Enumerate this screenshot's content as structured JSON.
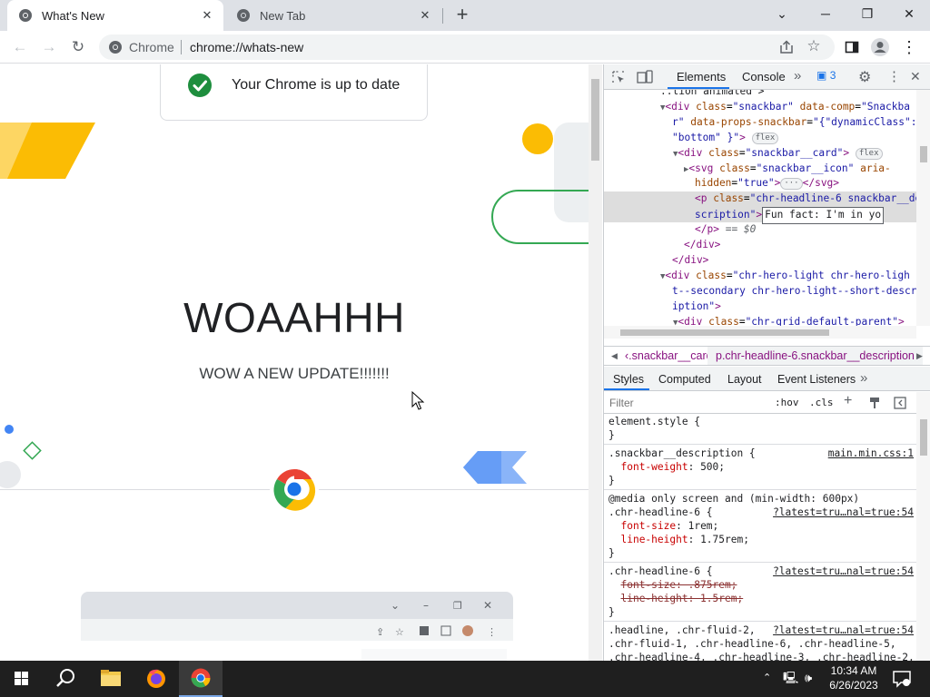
{
  "browser": {
    "tabs": [
      {
        "title": "What's New",
        "active": true
      },
      {
        "title": "New Tab",
        "active": false
      }
    ],
    "omnibox": {
      "chip": "Chrome",
      "url": "chrome://whats-new"
    }
  },
  "page": {
    "snackbar_text": "Your Chrome is up to date",
    "headline": "WOAAHHH",
    "subheadline": "WOW A NEW UPDATE!!!!!!!"
  },
  "devtools": {
    "tabs": [
      "Elements",
      "Console"
    ],
    "issues_count": "3",
    "dom_lines": [
      {
        "ind": 62,
        "html": "<span class='tx'>..tion animated\"&gt;</span>"
      },
      {
        "ind": 62,
        "html": "<span class='tri'>▼</span><span class='tag'>&lt;div</span> <span class='an'>class</span>=<span class='av'>\"snackbar\"</span> <span class='an'>data-comp</span>=<span class='av'>\"Snackba</span>"
      },
      {
        "ind": 75,
        "html": "<span class='av'>r\"</span> <span class='an'>data-props-snackbar</span>=<span class='av'>\"{\"dynamicClass\":</span>"
      },
      {
        "ind": 75,
        "html": "<span class='av'>\"bottom\" }\"</span><span class='tag'>&gt;</span> <span class='badge'>flex</span>"
      },
      {
        "ind": 76,
        "html": "<span class='tri'>▼</span><span class='tag'>&lt;div</span> <span class='an'>class</span>=<span class='av'>\"snackbar__card\"</span><span class='tag'>&gt;</span> <span class='badge'>flex</span>"
      },
      {
        "ind": 88,
        "html": "<span class='tri'>▶</span><span class='tag'>&lt;svg</span> <span class='an'>class</span>=<span class='av'>\"snackbar__icon\"</span> <span class='an'>aria-</span>"
      },
      {
        "ind": 100,
        "html": "<span class='an'>hidden</span>=<span class='av'>\"true\"</span><span class='tag'>&gt;</span><span class='badge'>···</span><span class='tag'>&lt;/svg&gt;</span>"
      },
      {
        "ind": 100,
        "sel": true,
        "html": "<span class='tag'>&lt;p</span> <span class='an'>class</span>=<span class='av'>\"chr-headline-6 snackbar__de</span>"
      },
      {
        "ind": 100,
        "sel": true,
        "html": "<span class='av'>scription\"</span><span class='tag'>&gt;</span><span id='edit-box' data-name='text-edit-box' data-interactable='true'>Fun fact: I'm in yo</span>"
      },
      {
        "ind": 100,
        "html": "<span class='tag'>&lt;/p&gt;</span> <span class='tx' style='color:#5f6368;font-style:italic'>== $0</span>"
      },
      {
        "ind": 88,
        "html": "<span class='tag'>&lt;/div&gt;</span>"
      },
      {
        "ind": 75,
        "html": "<span class='tag'>&lt;/div&gt;</span>"
      },
      {
        "ind": 62,
        "html": "<span class='tri'>▼</span><span class='tag'>&lt;div</span> <span class='an'>class</span>=<span class='av'>\"chr-hero-light chr-hero-ligh</span>"
      },
      {
        "ind": 75,
        "html": "<span class='av'>t--secondary chr-hero-light--short-descr</span>"
      },
      {
        "ind": 75,
        "html": "<span class='av'>iption\"</span><span class='tag'>&gt;</span>"
      },
      {
        "ind": 76,
        "html": "<span class='tri'>▼</span><span class='tag'>&lt;div</span> <span class='an'>class</span>=<span class='av'>\"chr-grid-default-parent\"</span><span class='tag'>&gt;</span>"
      }
    ],
    "breadcrumbs": [
      "‹.snackbar__card",
      "p.chr-headline-6.snackbar__description"
    ],
    "styles_tabs": [
      "Styles",
      "Computed",
      "Layout",
      "Event Listeners"
    ],
    "filter_placeholder": "Filter",
    "filter_hov": ":hov",
    "filter_cls": ".cls",
    "rules": [
      {
        "line": "element.style {",
        "src": ""
      },
      {
        "line": "}",
        "src": ""
      },
      {
        "line": ".snackbar__description {",
        "src": "main.min.css:1"
      },
      {
        "line": "  <span class='pn'>font-weight</span>: <span class='pv'>500</span>;",
        "src": ""
      },
      {
        "line": "}",
        "src": ""
      },
      {
        "line": "@media only screen and (min-width: 600px)",
        "src": ""
      },
      {
        "line": ".chr-headline-6 {",
        "src": "?latest=tru…nal=true:54"
      },
      {
        "line": "  <span class='pn'>font-size</span>: <span class='pv'>1rem</span>;",
        "src": ""
      },
      {
        "line": "  <span class='pn'>line-height</span>: <span class='pv'>1.75rem</span>;",
        "src": ""
      },
      {
        "line": "}",
        "src": ""
      },
      {
        "line": ".chr-headline-6 {",
        "src": "?latest=tru…nal=true:54"
      },
      {
        "line": "  <span class='struck'>font-size: .875rem;</span>",
        "src": ""
      },
      {
        "line": "  <span class='struck'>line-height: 1.5rem;</span>",
        "src": ""
      },
      {
        "line": "}",
        "src": ""
      },
      {
        "line": ".headline, .chr-fluid-2,",
        "src": "?latest=tru…nal=true:54"
      },
      {
        "line": ".chr-fluid-1, .chr-headline-6, .chr-headline-5,",
        "src": ""
      },
      {
        "line": ".chr-headline-4, .chr-headline-3, .chr-headline-2,",
        "src": ""
      }
    ]
  },
  "taskbar": {
    "time": "10:34 AM",
    "date": "6/26/2023"
  },
  "colors": {
    "accent": "#1a73e8",
    "check": "#1e8e3e",
    "yellow": "#fbbc04",
    "green": "#34a853"
  }
}
